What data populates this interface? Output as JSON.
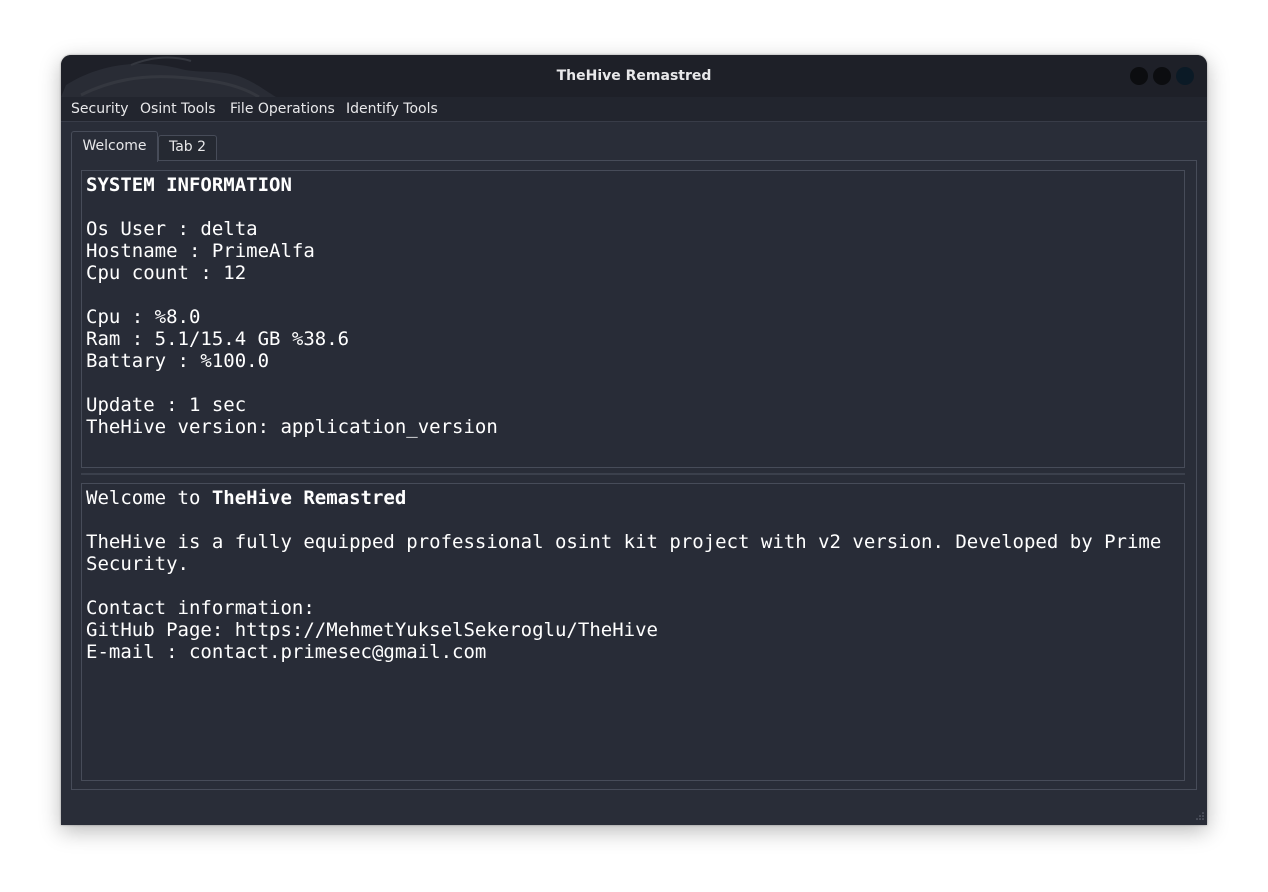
{
  "window": {
    "title": "TheHive Remastred"
  },
  "menu": {
    "items": [
      "Security",
      "Osint Tools",
      "File Operations",
      "Identify Tools"
    ]
  },
  "tabs": [
    "Welcome",
    "Tab 2"
  ],
  "system_info": {
    "heading": "SYSTEM INFORMATION",
    "os_user": "Os User : delta",
    "hostname": "Hostname : PrimeAlfa",
    "cpu_count": "Cpu count : 12",
    "cpu": "Cpu : %8.0",
    "ram": "Ram : 5.1/15.4 GB %38.6",
    "battery": "Battary : %100.0",
    "update": "Update : 1 sec",
    "version": "TheHive version: application_version"
  },
  "welcome": {
    "prefix": "Welcome to ",
    "app_name": "TheHive Remastred",
    "description": "TheHive is a fully equipped professional osint kit project with v2 version. Developed by Prime Security.",
    "contact_heading": "Contact information:",
    "github": "GitHub Page: https://MehmetYukselSekeroglu/TheHive",
    "email": "E-mail : contact.primesec@gmail.com"
  },
  "colors": {
    "window_bg": "#292d38",
    "titlebar_bg": "#1e2028",
    "text": "#ffffff",
    "border": "#474c59"
  }
}
